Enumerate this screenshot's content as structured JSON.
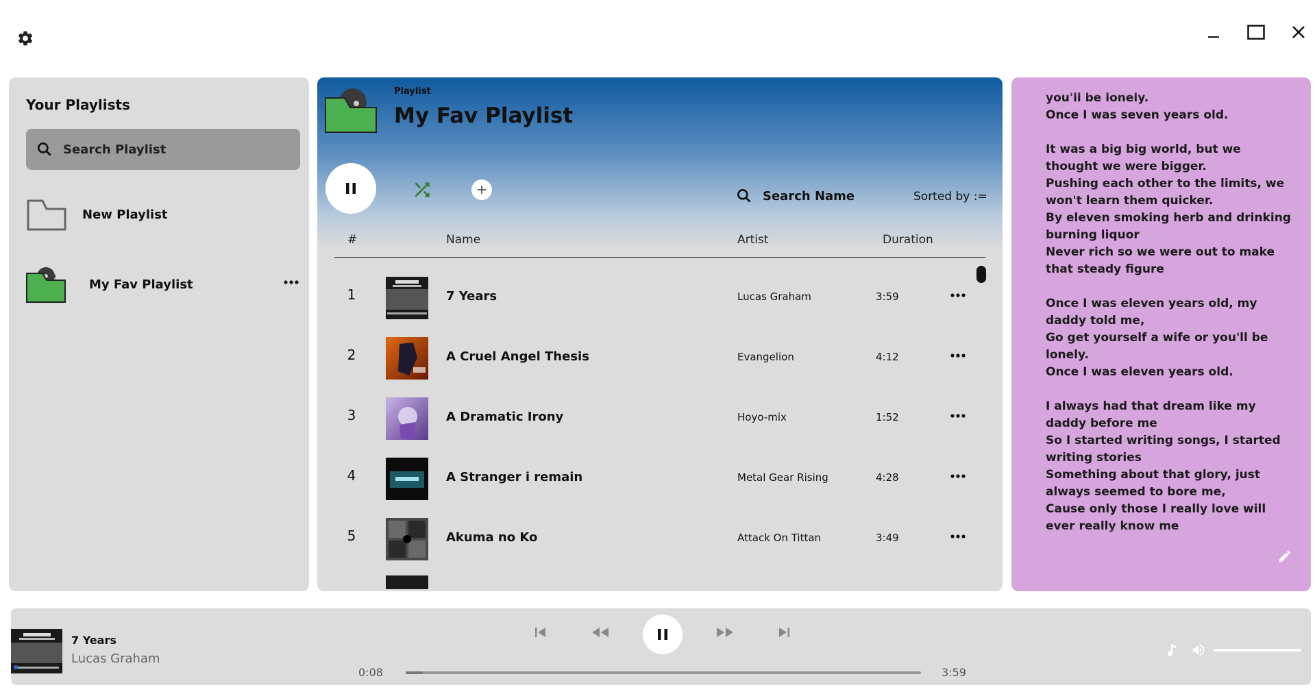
{
  "window": {
    "settings_icon": "gear-icon",
    "controls": [
      "minimize-icon",
      "maximize-icon",
      "close-icon"
    ]
  },
  "sidebar": {
    "title": "Your Playlists",
    "search_placeholder": "Search Playlist",
    "new_playlist_label": "New Playlist",
    "playlists": [
      {
        "name": "My Fav Playlist",
        "icon": "folder-vinyl-icon",
        "color": "#4caf50"
      }
    ]
  },
  "playlist": {
    "type_label": "Playlist",
    "title": "My Fav Playlist",
    "search_placeholder": "Search Name",
    "sort_label": "Sorted by :=",
    "columns": {
      "number": "#",
      "name": "Name",
      "artist": "Artist",
      "duration": "Duration"
    },
    "tracks": [
      {
        "num": "1",
        "name": "7 Years",
        "artist": "Lucas Graham",
        "duration": "3:59"
      },
      {
        "num": "2",
        "name": "A Cruel Angel Thesis",
        "artist": "Evangelion",
        "duration": "4:12"
      },
      {
        "num": "3",
        "name": "A Dramatic Irony",
        "artist": "Hoyo-mix",
        "duration": "1:52"
      },
      {
        "num": "4",
        "name": "A Stranger i remain",
        "artist": "Metal Gear Rising",
        "duration": "4:28"
      },
      {
        "num": "5",
        "name": "Akuma no Ko",
        "artist": "Attack On Tittan",
        "duration": "3:49"
      }
    ],
    "colors": {
      "header_top": "#0f5aa0",
      "shuffle": "#2e7d32"
    }
  },
  "lyrics": {
    "text": "you'll be lonely.\nOnce I was seven years old.\n\nIt was a big big world, but we thought we were bigger.\nPushing each other to the limits, we won't learn them quicker.\nBy eleven smoking herb and drinking burning liquor\nNever rich so we were out to make that steady figure\n\nOnce I was eleven years old, my daddy told me,\nGo get yourself a wife or you'll be lonely.\nOnce I was eleven years old.\n\nI always had that dream like my daddy before me\nSo I started writing songs, I started writing stories\nSomething about that glory, just always seemed to bore me,\nCause only those I really love will ever really know me",
    "background": "#d7a5de"
  },
  "player": {
    "title": "7 Years",
    "artist": "Lucas Graham",
    "current_time": "0:08",
    "total_time": "3:59",
    "progress_fraction": 0.033,
    "volume_fraction": 1.0
  }
}
